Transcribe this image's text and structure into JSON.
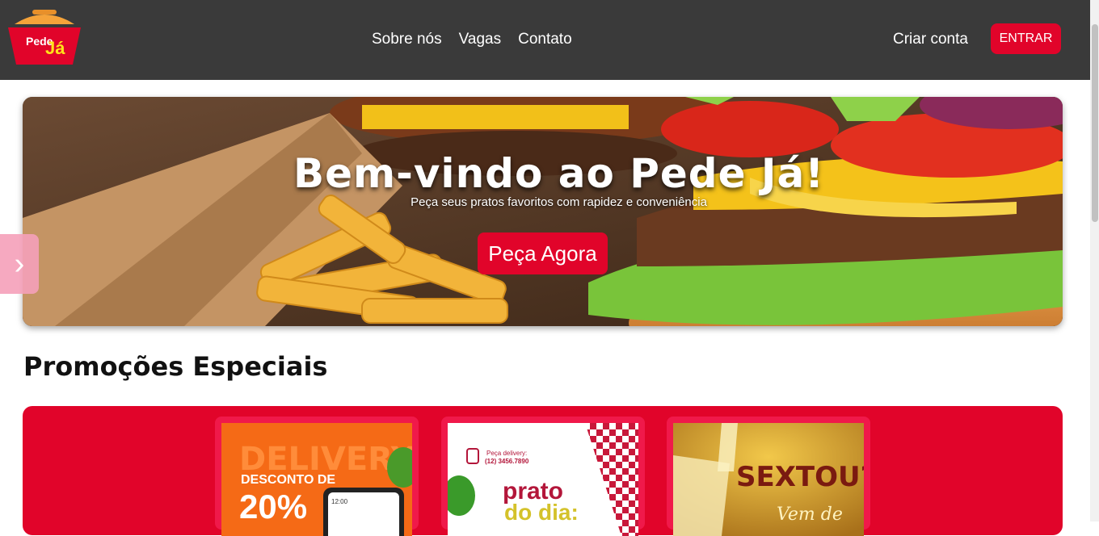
{
  "header": {
    "logo": {
      "text_top": "Pede",
      "text_bottom": "Já"
    },
    "nav": [
      "Sobre nós",
      "Vagas",
      "Contato"
    ],
    "create_account": "Criar conta",
    "login": "ENTRAR"
  },
  "hero": {
    "title": "Bem-vindo ao Pede Já!",
    "subtitle": "Peça seus pratos favoritos com rapidez e conveniência",
    "cta": "Peça Agora"
  },
  "promotions": {
    "title": "Promoções Especiais",
    "cards": [
      {
        "bg": "DELIVERY",
        "line1": "DESCONTO DE",
        "line2": "20%",
        "time": "12:00"
      },
      {
        "top": "Peça delivery:",
        "phone": "(12) 3456.7890",
        "line1": "prato",
        "line2": "do dia:"
      },
      {
        "line1": "SEXTOU?",
        "line2": "Vem de"
      }
    ]
  },
  "colors": {
    "header": "#3a3a3a",
    "accent": "#e1042a",
    "hero_bg": "#5a3a22"
  },
  "icons": {
    "carousel_next": "chevron-right-icon"
  }
}
